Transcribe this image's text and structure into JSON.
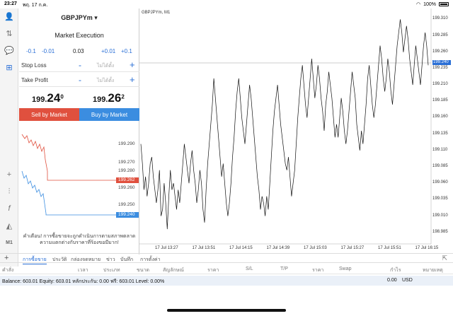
{
  "status": {
    "time": "23:27",
    "date": "พฤ. 17 ก.ค.",
    "battery": "100%"
  },
  "order": {
    "symbol": "GBPJPYm",
    "mode": "Market Execution",
    "lot_buttons": [
      "-0.1",
      "-0.01",
      "0.03",
      "+0.01",
      "+0.1"
    ],
    "stop_loss_label": "Stop Loss",
    "take_profit_label": "Take Profit",
    "sl_value": "ไม่ได้ตั้ง",
    "tp_value": "ไม่ได้ตั้ง",
    "bid_main": "199.",
    "bid_big": "24",
    "bid_sup": "0",
    "ask_main": "199.",
    "ask_big": "26",
    "ask_sup": "2",
    "sell_label": "Sell by Market",
    "buy_label": "Buy by Market",
    "mini_ticks": [
      "199.290",
      "199.280",
      "199.270",
      "199.260",
      "199.250"
    ],
    "ask_tag": "199.262",
    "bid_tag": "199.240",
    "notice_line1": "คำเตือน! การซื้อขายจะถูกดำเนินการตามสภาพตลาด",
    "notice_line2": "ความแตกต่างกับราคาที่ร้องขอมีมาก!",
    "colors": {
      "sell": "#e0503e",
      "buy": "#3b8de0",
      "ask_line": "#e0503e",
      "bid_line": "#3b8de0"
    }
  },
  "chart_title": "GBPJPYm, M1",
  "chart_data": {
    "type": "line",
    "y_ticks": [
      "199.310",
      "199.285",
      "199.260",
      "199.235",
      "199.210",
      "199.185",
      "199.160",
      "199.135",
      "199.110",
      "199.085",
      "199.060",
      "199.035",
      "199.010",
      "198.985"
    ],
    "y_tag": "199.240",
    "x_ticks": [
      "17 Jul 13:27",
      "17 Jul 13:51",
      "17 Jul 14:15",
      "17 Jul 14:39",
      "17 Jul 15:03",
      "17 Jul 15:27",
      "17 Jul 15:51",
      "17 Jul 16:15"
    ],
    "ylim": [
      198.975,
      199.318
    ],
    "values": [
      199.12,
      199.09,
      199.05,
      199.07,
      199.04,
      199.06,
      199.09,
      199.1,
      199.07,
      199.05,
      199.03,
      199.05,
      199.08,
      199.01,
      199.02,
      199.06,
      199.03,
      198.99,
      199.04,
      199.08,
      199.05,
      199.06,
      199.04,
      199.02,
      199.05,
      199.03,
      199.06,
      199.09,
      199.12,
      199.1,
      199.08,
      199.06,
      199.09,
      199.11,
      199.08,
      199.06,
      199.03,
      199.05,
      199.08,
      199.06,
      199.02,
      199.0,
      199.05,
      199.09,
      199.12,
      199.15,
      199.18,
      199.22,
      199.19,
      199.16,
      199.13,
      199.1,
      199.07,
      199.09,
      199.06,
      199.03,
      199.01,
      199.03,
      199.06,
      199.1,
      199.13,
      199.17,
      199.2,
      199.22,
      199.19,
      199.16,
      199.14,
      199.12,
      199.15,
      199.18,
      199.21,
      199.19,
      199.16,
      199.13,
      199.1,
      199.07,
      199.05,
      199.02,
      199.04,
      199.03,
      199.01,
      199.04,
      199.02,
      199.06,
      199.1,
      199.14,
      199.17,
      199.19,
      199.21,
      199.18,
      199.15,
      199.13,
      199.11,
      199.09,
      199.08,
      199.1,
      199.07,
      199.04,
      199.06,
      199.08,
      199.12,
      199.16,
      199.19,
      199.22,
      199.24,
      199.21,
      199.18,
      199.16,
      199.19,
      199.22,
      199.25,
      199.22,
      199.19,
      199.21,
      199.24,
      199.22,
      199.19,
      199.17,
      199.14,
      199.18,
      199.2,
      199.23,
      199.21,
      199.19,
      199.16,
      199.13,
      199.15,
      199.13,
      199.16,
      199.19,
      199.17,
      199.14,
      199.12,
      199.14,
      199.17,
      199.2,
      199.23,
      199.21,
      199.19,
      199.15,
      199.13,
      199.11,
      199.14,
      199.12,
      199.15,
      199.18,
      199.22,
      199.24,
      199.21,
      199.18,
      199.16,
      199.18,
      199.21,
      199.24,
      199.27,
      199.25,
      199.22,
      199.2,
      199.22,
      199.25,
      199.23,
      199.2,
      199.18,
      199.21,
      199.24,
      199.27,
      199.29,
      199.31,
      199.29,
      199.26,
      199.28,
      199.3,
      199.28,
      199.25,
      199.23,
      199.21,
      199.24,
      199.27,
      199.25,
      199.23,
      199.21,
      199.24,
      199.27,
      199.29,
      199.27,
      199.24
    ]
  },
  "tabs": [
    "การซื้อขาย",
    "ประวัติ",
    "กล่องจดหมาย",
    "ข่าว",
    "บันทึก",
    "การตั้งค่า"
  ],
  "columns": [
    "คำสั่ง",
    "เวลา",
    "ประเภท",
    "ขนาด",
    "สัญลักษณ์",
    "ราคา",
    "S/L",
    "T/P",
    "ราคา",
    "Swap",
    "กำไร",
    "หมายเหตุ"
  ],
  "balance_text": "Balance: 603.01 Equity: 603.01 หลักประกัน: 0.00 ฟรี: 603.01 Level: 0.00%",
  "balance_amount": "0.00",
  "balance_currency": "USD"
}
